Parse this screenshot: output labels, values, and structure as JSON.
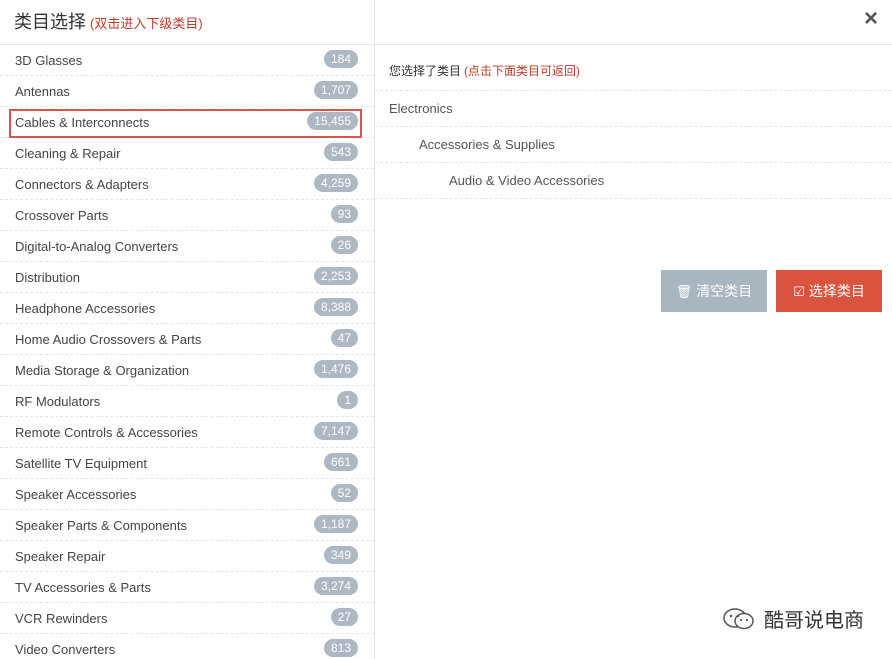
{
  "header": {
    "title": "类目选择",
    "hint": "(双击进入下级类目)"
  },
  "close_icon": "×",
  "categories": [
    {
      "label": "3D Glasses",
      "count": "184"
    },
    {
      "label": "Antennas",
      "count": "1,707"
    },
    {
      "label": "Cables & Interconnects",
      "count": "15,455"
    },
    {
      "label": "Cleaning & Repair",
      "count": "543"
    },
    {
      "label": "Connectors & Adapters",
      "count": "4,259"
    },
    {
      "label": "Crossover Parts",
      "count": "93"
    },
    {
      "label": "Digital-to-Analog Converters",
      "count": "26"
    },
    {
      "label": "Distribution",
      "count": "2,253"
    },
    {
      "label": "Headphone Accessories",
      "count": "8,388"
    },
    {
      "label": "Home Audio Crossovers & Parts",
      "count": "47"
    },
    {
      "label": "Media Storage & Organization",
      "count": "1,476"
    },
    {
      "label": "RF Modulators",
      "count": "1"
    },
    {
      "label": "Remote Controls & Accessories",
      "count": "7,147"
    },
    {
      "label": "Satellite TV Equipment",
      "count": "661"
    },
    {
      "label": "Speaker Accessories",
      "count": "52"
    },
    {
      "label": "Speaker Parts & Components",
      "count": "1,187"
    },
    {
      "label": "Speaker Repair",
      "count": "349"
    },
    {
      "label": "TV Accessories & Parts",
      "count": "3,274"
    },
    {
      "label": "VCR Rewinders",
      "count": "27"
    },
    {
      "label": "Video Converters",
      "count": "813"
    }
  ],
  "selected_category_index": 2,
  "right": {
    "selected_label": "您选择了类目",
    "selected_note": "(点击下面类目可返回)",
    "path": [
      "Electronics",
      "Accessories & Supplies",
      "Audio & Video Accessories"
    ]
  },
  "buttons": {
    "clear_label": "清空类目",
    "clear_icon": "trash-icon",
    "select_label": "选择类目",
    "select_icon": "checkbox-icon"
  },
  "watermark": {
    "text": "酷哥说电商",
    "icon": "wechat-icon"
  },
  "colors": {
    "highlight_border": "#d9534f",
    "hint_text": "#c0392b",
    "badge_bg": "#aeb8c2",
    "clear_btn": "#a7b6bf",
    "select_btn": "#d9533f"
  }
}
